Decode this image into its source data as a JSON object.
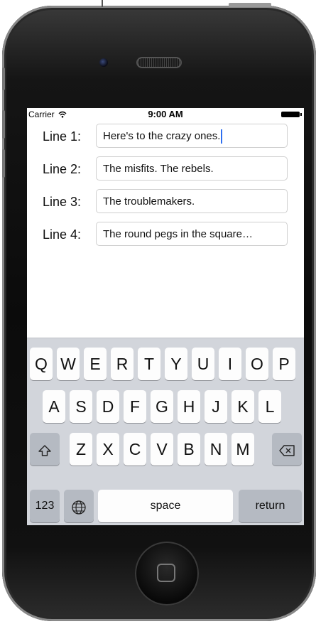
{
  "status_bar": {
    "carrier": "Carrier",
    "time": "9:00 AM"
  },
  "icons": {
    "wifi": "wifi-icon",
    "battery": "battery-icon",
    "shift": "shift-icon",
    "delete": "delete-icon",
    "globe": "globe-icon",
    "home": "home-button-icon"
  },
  "lines": [
    {
      "label": "Line 1:",
      "value": "Here's to the crazy ones."
    },
    {
      "label": "Line 2:",
      "value": "The misfits. The rebels."
    },
    {
      "label": "Line 3:",
      "value": "The troublemakers."
    },
    {
      "label": "Line 4:",
      "value": "The round pegs in the square…"
    }
  ],
  "keyboard": {
    "row1": [
      "Q",
      "W",
      "E",
      "R",
      "T",
      "Y",
      "U",
      "I",
      "O",
      "P"
    ],
    "row2": [
      "A",
      "S",
      "D",
      "F",
      "G",
      "H",
      "J",
      "K",
      "L"
    ],
    "row3": [
      "Z",
      "X",
      "C",
      "V",
      "B",
      "N",
      "M"
    ],
    "numbers_key": "123",
    "space_key": "space",
    "return_key": "return"
  }
}
